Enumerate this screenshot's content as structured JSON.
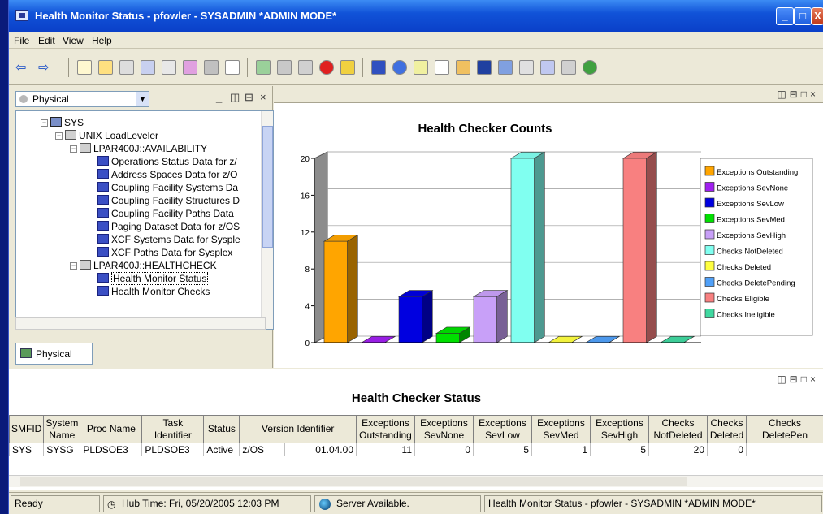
{
  "window": {
    "title": "Health Monitor Status - pfowler - SYSADMIN   *ADMIN MODE*",
    "controls": {
      "minimize": "_",
      "maximize": "□",
      "close": "X"
    }
  },
  "menu": [
    "File",
    "Edit",
    "View",
    "Help"
  ],
  "navigator": {
    "view_select": "Physical",
    "tab_label": "Physical",
    "tree": [
      {
        "label": "SYS",
        "level": 0
      },
      {
        "label": "UNIX LoadLeveler",
        "level": 1
      },
      {
        "label": "LPAR400J::AVAILABILITY",
        "level": 2
      },
      {
        "label": "Operations Status Data for z/",
        "level": 3
      },
      {
        "label": "Address Spaces Data for z/O",
        "level": 3
      },
      {
        "label": "Coupling Facility Systems Da",
        "level": 3
      },
      {
        "label": "Coupling Facility Structures D",
        "level": 3
      },
      {
        "label": "Coupling Facility Paths Data",
        "level": 3
      },
      {
        "label": "Paging Dataset Data for z/OS",
        "level": 3
      },
      {
        "label": "XCF Systems Data for Sysple",
        "level": 3
      },
      {
        "label": "XCF Paths Data for Sysplex",
        "level": 3
      },
      {
        "label": "LPAR400J::HEALTHCHECK",
        "level": 2
      },
      {
        "label": "Health Monitor Status",
        "level": 3,
        "selected": true
      },
      {
        "label": "Health Monitor Checks",
        "level": 3
      }
    ]
  },
  "chart_data": {
    "type": "bar",
    "title": "Health Checker Counts",
    "categories": [
      "Exceptions Outstanding",
      "Exceptions SevNone",
      "Exceptions SevLow",
      "Exceptions SevMed",
      "Exceptions SevHigh",
      "Checks NotDeleted",
      "Checks Deleted",
      "Checks DeletePending",
      "Checks Eligible",
      "Checks Ineligible"
    ],
    "values": [
      11,
      0,
      5,
      1,
      5,
      20,
      0,
      0,
      20,
      0
    ],
    "colors": [
      "#ffa500",
      "#a020f0",
      "#0000e0",
      "#00e000",
      "#c8a0f8",
      "#80fff0",
      "#ffff40",
      "#50a0f8",
      "#f88080",
      "#40d8a0"
    ],
    "ylim": [
      0,
      20
    ],
    "yticks": [
      0,
      4,
      8,
      12,
      16,
      20
    ],
    "legend": "right",
    "grid": true
  },
  "table": {
    "title": "Health Checker Status",
    "columns": [
      "SMFID",
      "System Name",
      "Proc Name",
      "Task Identifier",
      "Status",
      "Version Identifier",
      "Exceptions Outstanding",
      "Exceptions SevNone",
      "Exceptions SevLow",
      "Exceptions SevMed",
      "Exceptions SevHigh",
      "Checks NotDeleted",
      "Checks Deleted",
      "Checks DeletePen"
    ],
    "rows": [
      [
        "SYS",
        "SYSG",
        "PLDSOE3",
        "PLDSOE3",
        "Active",
        "z/OS",
        "01.04.00",
        "11",
        "0",
        "5",
        "1",
        "5",
        "20",
        "0"
      ]
    ]
  },
  "status": {
    "ready": "Ready",
    "hub_time": "Hub Time: Fri, 05/20/2005 12:03 PM",
    "server": "Server Available.",
    "workspace": "Health Monitor Status - pfowler - SYSADMIN   *ADMIN MODE*"
  }
}
